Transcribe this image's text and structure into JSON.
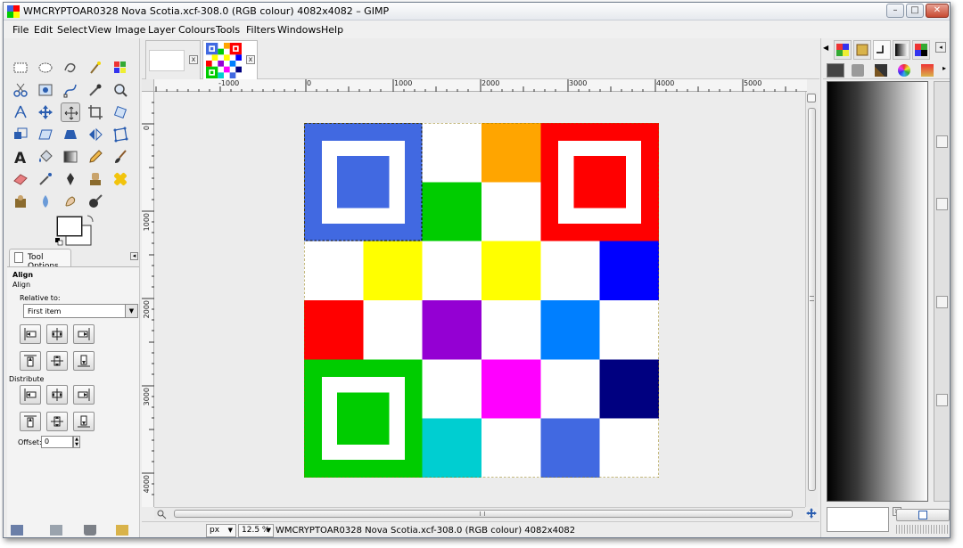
{
  "window": {
    "title": "WMCRYPTOAR0328 Nova Scotia.xcf-308.0 (RGB colour) 4082x4082 – GIMP",
    "controls": {
      "minimize": "–",
      "maximize": "□",
      "close": "✕"
    }
  },
  "menu": [
    "File",
    "Edit",
    "Select",
    "View",
    "Image",
    "Layer",
    "Colours",
    "Tools",
    "Filters",
    "Windows",
    "Help"
  ],
  "tool_options": {
    "tab_label": "Tool Options",
    "heading": "Align",
    "subheading": "Align",
    "relative_to_label": "Relative to:",
    "relative_to_value": "First item",
    "distribute_label": "Distribute",
    "offset_label": "Offset:",
    "offset_value": "0"
  },
  "image_tabs": {
    "close_glyph": "x"
  },
  "rulers": {
    "horizontal": [
      "-1000",
      "0",
      "1000",
      "2000",
      "3000",
      "4000",
      "5000"
    ],
    "vertical": [
      "0",
      "1000",
      "2000",
      "3000",
      "4000"
    ]
  },
  "status": {
    "unit": "px",
    "zoom": "12.5 %",
    "text": "WMCRYPTOAR0328 Nova Scotia.xcf-308.0 (RGB colour) 4082x4082"
  },
  "image": {
    "grid": [
      [
        "#4169e1",
        "#4169e1",
        "#ffffff",
        "#ffa500",
        "#ff0000",
        "#ff0000"
      ],
      [
        "#4169e1",
        "#4169e1",
        "#00cc00",
        "#ffffff",
        "#ff0000",
        "#ff0000"
      ],
      [
        "#ffffff",
        "#ffff00",
        "#ffffff",
        "#ffff00",
        "#ffffff",
        "#0000ff"
      ],
      [
        "#ff0000",
        "#ffffff",
        "#9400d3",
        "#ffffff",
        "#007fff",
        "#ffffff"
      ],
      [
        "#00cc00",
        "#00cc00",
        "#ffffff",
        "#ff00ff",
        "#ffffff",
        "#000080"
      ],
      [
        "#00cc00",
        "#00cc00",
        "#00ced1",
        "#ffffff",
        "#4169e1",
        "#ffffff"
      ]
    ],
    "finders": [
      {
        "position": "top-left",
        "color": "#4169e1"
      },
      {
        "position": "top-right",
        "color": "#ff0000"
      },
      {
        "position": "bottom-left",
        "color": "#00cc00"
      }
    ]
  },
  "colors": {
    "selection": "#000000",
    "accent": "#4169e1"
  }
}
